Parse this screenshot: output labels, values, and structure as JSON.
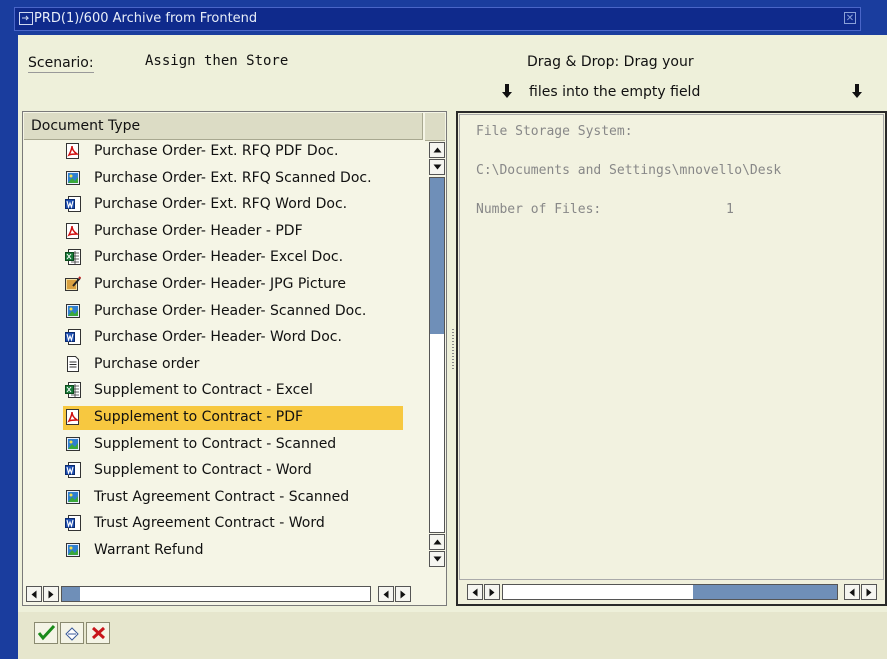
{
  "window": {
    "title": "PRD(1)/600 Archive from Frontend"
  },
  "scenario": {
    "label": "Scenario:",
    "value": "Assign then Store"
  },
  "drag_drop": {
    "line1": "Drag & Drop: Drag your",
    "line2": "files into the empty field"
  },
  "document_type": {
    "header": "Document Type",
    "items": [
      {
        "label": "Purchase Order- Ext. RFQ PDF Doc.",
        "icon": "pdf-icon",
        "selected": false
      },
      {
        "label": "Purchase Order- Ext. RFQ Scanned Doc.",
        "icon": "image-icon",
        "selected": false
      },
      {
        "label": "Purchase Order- Ext. RFQ Word Doc.",
        "icon": "word-icon",
        "selected": false
      },
      {
        "label": "Purchase Order- Header - PDF",
        "icon": "pdf-icon",
        "selected": false
      },
      {
        "label": "Purchase Order- Header- Excel Doc.",
        "icon": "excel-icon",
        "selected": false
      },
      {
        "label": "Purchase Order- Header- JPG Picture",
        "icon": "picture-edit-icon",
        "selected": false
      },
      {
        "label": "Purchase Order- Header- Scanned Doc.",
        "icon": "image-icon",
        "selected": false
      },
      {
        "label": "Purchase Order- Header- Word Doc.",
        "icon": "word-icon",
        "selected": false
      },
      {
        "label": "Purchase order",
        "icon": "document-icon",
        "selected": false
      },
      {
        "label": "Supplement to Contract - Excel",
        "icon": "excel-icon",
        "selected": false
      },
      {
        "label": "Supplement to Contract - PDF",
        "icon": "pdf-icon",
        "selected": true
      },
      {
        "label": "Supplement to Contract - Scanned",
        "icon": "image-icon",
        "selected": false
      },
      {
        "label": "Supplement to Contract - Word",
        "icon": "word-icon",
        "selected": false
      },
      {
        "label": "Trust Agreement Contract - Scanned",
        "icon": "image-icon",
        "selected": false
      },
      {
        "label": "Trust Agreement Contract - Word",
        "icon": "word-icon",
        "selected": false
      },
      {
        "label": "Warrant Refund",
        "icon": "image-icon",
        "selected": false
      }
    ]
  },
  "file_storage": {
    "title": "File Storage System:",
    "path": "C:\\Documents and Settings\\mnovello\\Desk",
    "count_label": "Number of Files:",
    "count_value": "1"
  },
  "footer": {
    "buttons": [
      "confirm-icon",
      "assign-icon",
      "cancel-icon"
    ]
  },
  "colors": {
    "selection": "#f7c840",
    "title_bar": "#0f2a8c",
    "background": "#1a3d9e"
  }
}
